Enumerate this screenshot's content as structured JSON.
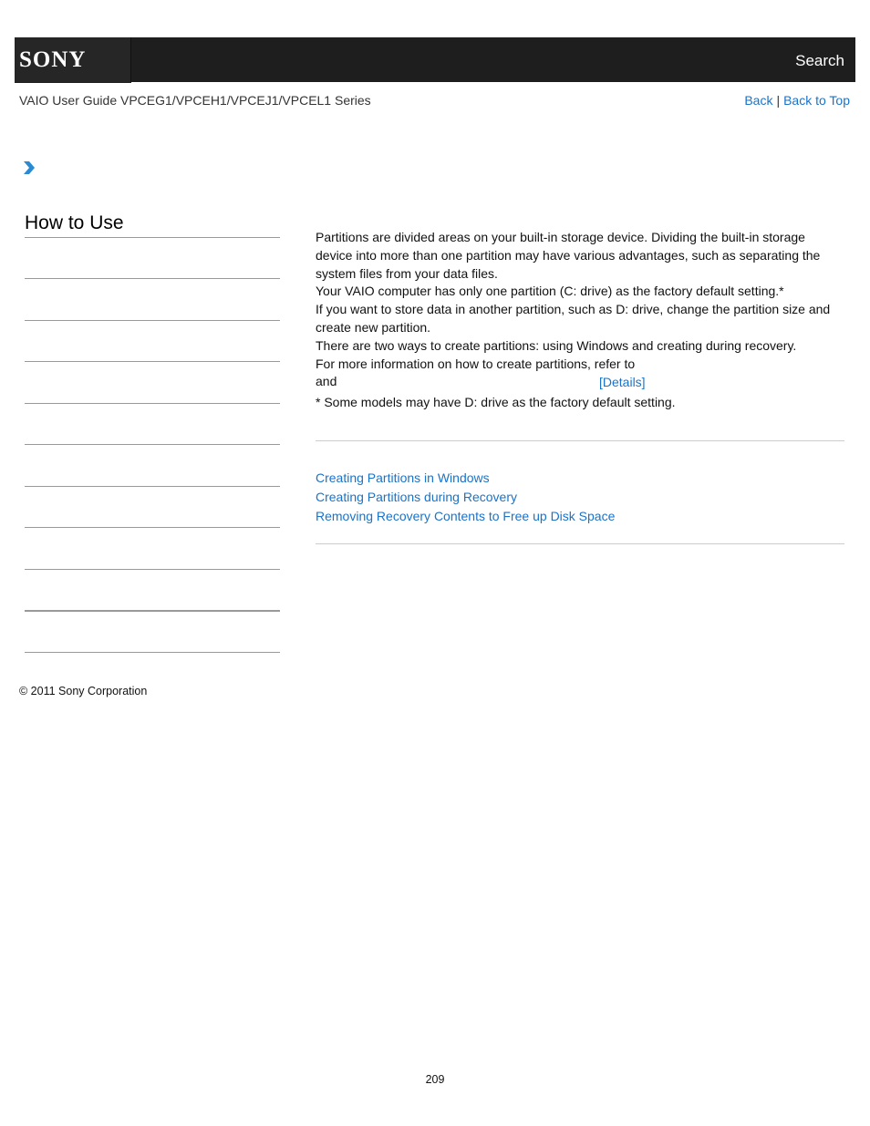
{
  "header": {
    "logo": "SONY",
    "search_label": "Search"
  },
  "subheader": {
    "guide_title": "VAIO User Guide VPCEG1/VPCEH1/VPCEJ1/VPCEL1 Series",
    "back_label": "Back",
    "separator": "|",
    "back_to_top_label": "Back to Top"
  },
  "sidebar": {
    "title": "How to Use",
    "item_count": 10
  },
  "content": {
    "paragraph_lines": [
      "Partitions are divided areas on your built-in storage device. Dividing the built-in storage device into more than one partition may have various advantages, such as separating the system files from your data files.",
      "Your VAIO computer has only one partition (C: drive) as the factory default setting.*",
      "If you want to store data in another partition, such as D: drive, change the partition size and create new partition.",
      "There are two ways to create partitions: using Windows and creating during recovery.",
      "For more information on how to create partitions, refer to",
      "and"
    ],
    "details_link": "[Details]",
    "footnote": "* Some models may have D: drive as the factory default setting."
  },
  "related_topics": [
    "Creating Partitions in Windows",
    "Creating Partitions during Recovery",
    "Removing Recovery Contents to Free up Disk Space"
  ],
  "footer": {
    "copyright": "© 2011 Sony Corporation",
    "page_number": "209"
  },
  "colors": {
    "header_bg": "#1e1e1e",
    "link": "#1a73c8",
    "chevron": "#2a8ad4"
  }
}
